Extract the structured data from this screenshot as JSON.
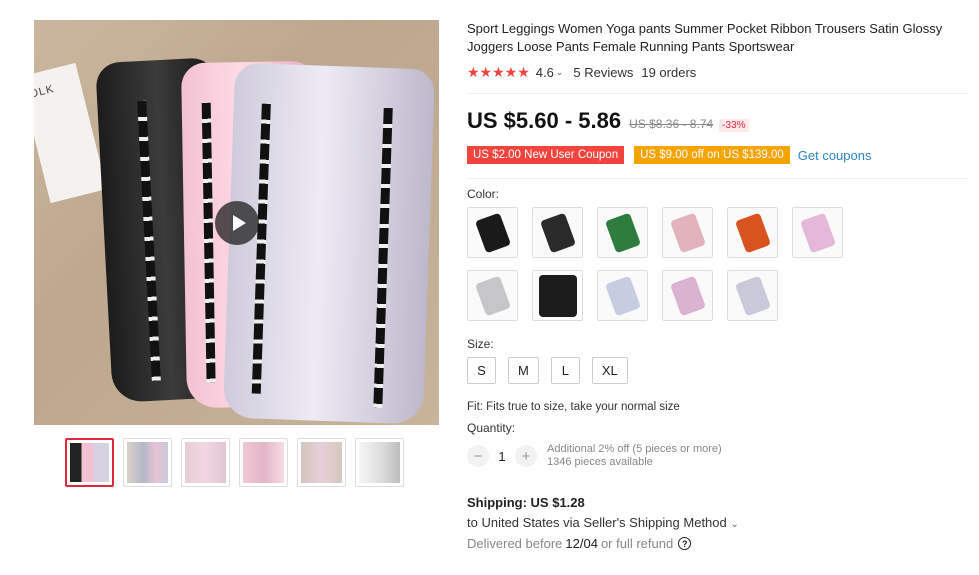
{
  "product": {
    "title": "Sport Leggings Women Yoga pants Summer Pocket Ribbon Trousers Satin Glossy Joggers Loose Pants Female Running Pants Sportswear",
    "rating_stars": "★★★★★",
    "rating_value": "4.6",
    "reviews": "5 Reviews",
    "orders": "19 orders"
  },
  "gallery": {
    "booklet_text": "OLK",
    "thumbnails": [
      "thumb-1",
      "thumb-2",
      "thumb-3",
      "thumb-4",
      "thumb-5",
      "thumb-6"
    ]
  },
  "price": {
    "current": "US $5.60 - 5.86",
    "original": "US $8.36 - 8.74",
    "discount": "-33%"
  },
  "coupons": {
    "new_user": "US $2.00 New User Coupon",
    "store": "US $9.00 off on US $139.00",
    "get_link": "Get coupons"
  },
  "color": {
    "label": "Color:",
    "swatch_colors": [
      "#1a1a1a",
      "#2a2a2a",
      "#2e7d3e",
      "#e2b3bd",
      "#d9531e",
      "#e3b8d9",
      "#c6c6c9",
      "#1c1c1c",
      "#c7cde0",
      "#d9b3cf",
      "#c9c9d9"
    ]
  },
  "size": {
    "label": "Size:",
    "options": [
      "S",
      "M",
      "L",
      "XL"
    ],
    "fit_note": "Fit: Fits true to size, take your normal size"
  },
  "quantity": {
    "label": "Quantity:",
    "value": "1",
    "minus": "−",
    "plus": "+",
    "discount_note": "Additional 2% off (5 pieces or more)",
    "available": "1346 pieces available"
  },
  "shipping": {
    "title": "Shipping: US $1.28",
    "destination": "to United States via Seller's Shipping Method",
    "chevron": "⌄",
    "delivered_prefix": "Delivered before",
    "delivered_date": "12/04",
    "delivered_suffix": "or full refund",
    "help_glyph": "?"
  },
  "colors": {
    "accent_red": "#f0443c",
    "coupon_orange": "#f7a300",
    "link_blue": "#2e85c5"
  }
}
